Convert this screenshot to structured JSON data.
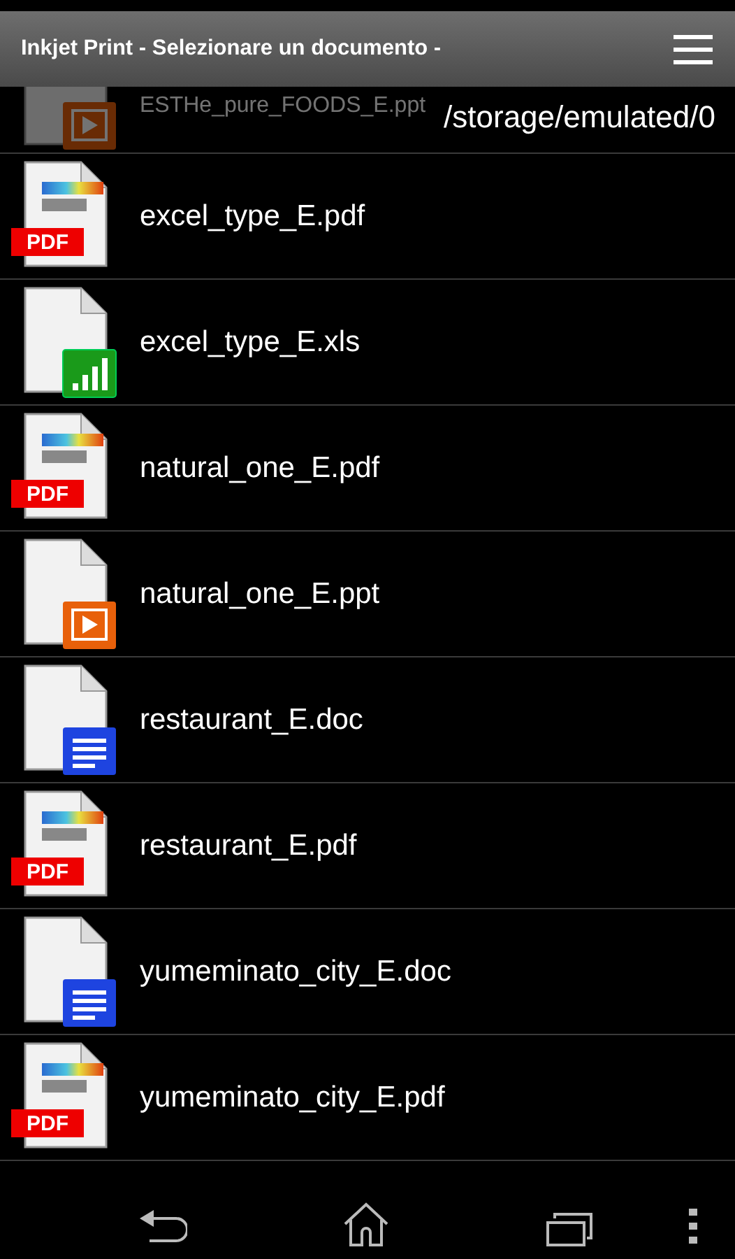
{
  "title_bar": {
    "title": "Inkjet Print  - Selezionare un documento -"
  },
  "current_path": "/storage/emulated/0",
  "files": [
    {
      "name": "ESTHe_pure_FOODS_E.ppt",
      "kind": "ppt",
      "faded": true
    },
    {
      "name": "excel_type_E.pdf",
      "kind": "pdf",
      "faded": false,
      "badge": "PDF"
    },
    {
      "name": "excel_type_E.xls",
      "kind": "xls",
      "faded": false
    },
    {
      "name": "natural_one_E.pdf",
      "kind": "pdf",
      "faded": false,
      "badge": "PDF"
    },
    {
      "name": "natural_one_E.ppt",
      "kind": "ppt",
      "faded": false
    },
    {
      "name": "restaurant_E.doc",
      "kind": "doc",
      "faded": false
    },
    {
      "name": "restaurant_E.pdf",
      "kind": "pdf",
      "faded": false,
      "badge": "PDF"
    },
    {
      "name": "yumeminato_city_E.doc",
      "kind": "doc",
      "faded": false
    },
    {
      "name": "yumeminato_city_E.pdf",
      "kind": "pdf",
      "faded": false,
      "badge": "PDF"
    }
  ]
}
